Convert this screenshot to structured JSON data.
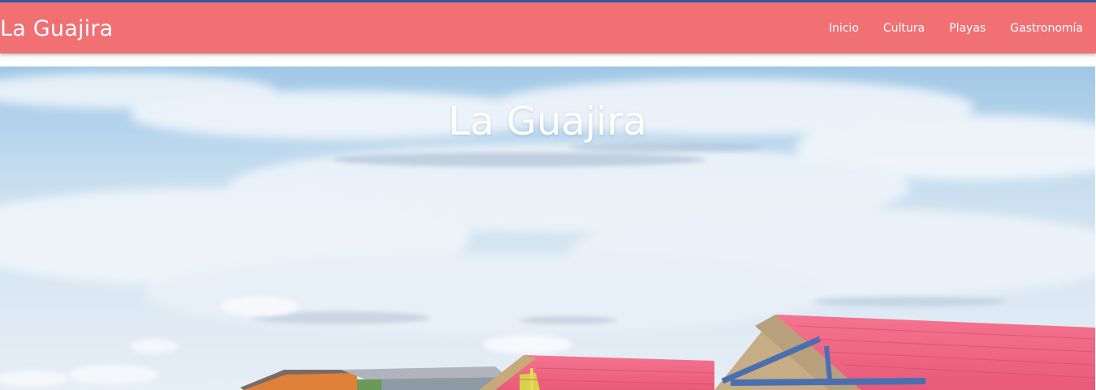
{
  "navbar": {
    "brand": "La Guajira",
    "links": [
      {
        "label": "Inicio"
      },
      {
        "label": "Cultura"
      },
      {
        "label": "Playas"
      },
      {
        "label": "Gastronomía"
      }
    ],
    "background_color": "#f07074",
    "text_color": "#ffffff"
  },
  "hero": {
    "title": "La Guajira",
    "image": "sky-with-colorful-tin-roofs-photo"
  }
}
